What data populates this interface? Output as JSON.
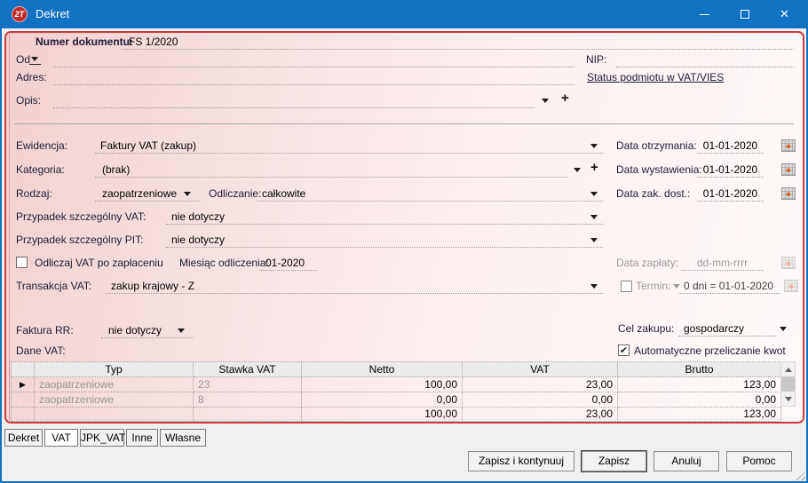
{
  "win": {
    "title": "Dekret",
    "icon_text": "2T"
  },
  "doc": {
    "numer_label": "Numer dokumentu:",
    "numer_value": "FS 1/2020",
    "od_label": "Od",
    "adres_label": "Adres:",
    "opis_label": "Opis:",
    "nip_label": "NIP:",
    "vies_link": "Status podmiotu w VAT/VIES"
  },
  "form": {
    "ewidencja_label": "Ewidencja:",
    "ewidencja_value": "Faktury VAT (zakup)",
    "kategoria_label": "Kategoria:",
    "kategoria_value": "(brak)",
    "rodzaj_label": "Rodzaj:",
    "rodzaj_value": "zaopatrzeniowe",
    "odliczanie_label": "Odliczanie:",
    "odliczanie_value": "całkowite",
    "przypadek_vat_label": "Przypadek szczególny VAT:",
    "przypadek_vat_value": "nie dotyczy",
    "przypadek_pit_label": "Przypadek szczególny PIT:",
    "przypadek_pit_value": "nie dotyczy",
    "odliczaj_vat_label": "Odliczaj VAT po zapłaceniu",
    "odliczaj_vat_checked": false,
    "miesiac_label": "Miesiąc odliczenia:",
    "miesiac_value": "01-2020",
    "transakcja_label": "Transakcja VAT:",
    "transakcja_value": "zakup krajowy - Z",
    "faktura_rr_label": "Faktura RR:",
    "faktura_rr_value": "nie dotyczy",
    "cel_label": "Cel zakupu:",
    "cel_value": "gospodarczy",
    "dane_vat_label": "Dane VAT:",
    "auto_przeliczanie_label": "Automatyczne przeliczanie kwot",
    "auto_przeliczanie_checked": true
  },
  "dates": {
    "otrzymania_label": "Data otrzymania:",
    "otrzymania_value": "01-01-2020",
    "wystawienia_label": "Data wystawienia:",
    "wystawienia_value": "01-01-2020",
    "zak_dost_label": "Data zak. dost.:",
    "zak_dost_value": "01-01-2020",
    "zaplaty_label": "Data zapłaty:",
    "zaplaty_placeholder": "dd-mm-rrrr",
    "termin_label": "Termin:",
    "termin_checked": false,
    "termin_dni": "0 dni =",
    "termin_value": "01-01-2020"
  },
  "vat_table": {
    "headers": [
      "Typ",
      "Stawka VAT",
      "Netto",
      "VAT",
      "Brutto"
    ],
    "rows": [
      {
        "typ": "zaopatrzeniowe",
        "stawka": "23",
        "netto": "100,00",
        "vat": "23,00",
        "brutto": "123,00"
      },
      {
        "typ": "zaopatrzeniowe",
        "stawka": "8",
        "netto": "0,00",
        "vat": "0,00",
        "brutto": "0,00"
      }
    ],
    "total": {
      "netto": "100,00",
      "vat": "23,00",
      "brutto": "123,00"
    }
  },
  "tabs": [
    "Dekret",
    "VAT",
    "JPK_VAT",
    "Inne",
    "Własne"
  ],
  "active_tab": "VAT",
  "buttons": {
    "save_continue": "Zapisz i kontynuuj",
    "save": "Zapisz",
    "cancel": "Anuluj",
    "help": "Pomoc"
  },
  "colors": {
    "titlebar_blue": "#1171c2",
    "form_border_red": "#cc3b3b",
    "form_bg_pink": "#f4cfcf",
    "calendar_dot_orange": "#d8622f",
    "disabled_text_gray": "#9b9b9b",
    "grid_header_gray": "#ebebeb"
  }
}
